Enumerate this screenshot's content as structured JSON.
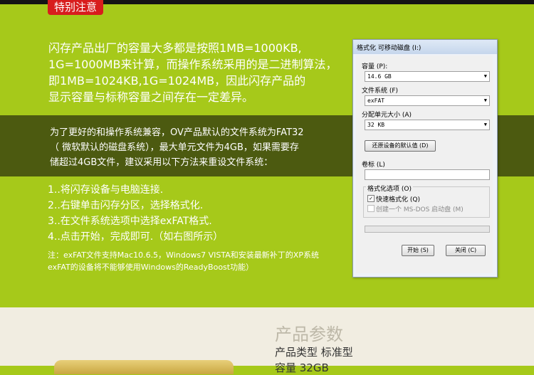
{
  "header": {
    "tag_label": "特别注意"
  },
  "intro": {
    "lines": [
      "闪存产品出厂的容量大多都是按照1MB=1000KB,",
      "1G=1000MB来计算，而操作系统采用的是二进制算法，",
      "即1MB=1024KB,1G=1024MB，因此闪存产品的",
      "显示容量与标称容量之间存在一定差异。"
    ]
  },
  "band": {
    "lines": [
      "为了更好的和操作系统兼容，OV产品默认的文件系统为FAT32",
      "（ 微软默认的磁盘系统），最大单元文件为4GB，如果需要存",
      "储超过4GB文件，建议采用以下方法来重设文件系统："
    ]
  },
  "steps": [
    "1..将闪存设备与电脑连接.",
    "2..右键单击闪存分区，选择格式化.",
    "3..在文件系统选项中选择exFAT格式.",
    "4..点击开始，完成即可.（如右图所示）"
  ],
  "note": {
    "lines": [
      "注：exFAT文件支持Mac10.6.5，Windows7  VISTA和安装最新补丁的XP系统",
      "exFAT的设备将不能够使用Windows的ReadyBoost功能）"
    ]
  },
  "dialog": {
    "title": "格式化 可移动磁盘 (I:)",
    "capacity_label": "容量 (P):",
    "capacity_value": "14.6 GB",
    "filesystem_label": "文件系统 (F)",
    "filesystem_value": "exFAT",
    "unit_label": "分配单元大小 (A)",
    "unit_value": "32 KB",
    "restore_button": "还原设备的默认值 (D)",
    "volume_label": "卷标 (L)",
    "volume_value": "",
    "options_label": "格式化选项 (O)",
    "quick_format_label": "快速格式化 (Q)",
    "quick_format_checked": true,
    "msdos_label": "创建一个 MS-DOS 启动盘 (M)",
    "msdos_checked": false,
    "start_button": "开始 (S)",
    "close_button": "关闭 (C)",
    "arrow_glyph": "▼",
    "check_glyph": "✓"
  },
  "params": {
    "title": "产品参数",
    "type_row": "产品类型 标准型",
    "capacity_row": "容量 32GB"
  },
  "colors": {
    "background": "#a6c91a",
    "band": "#4c5a10",
    "tag": "#d81d1d",
    "bottom": "#f1ede1"
  }
}
